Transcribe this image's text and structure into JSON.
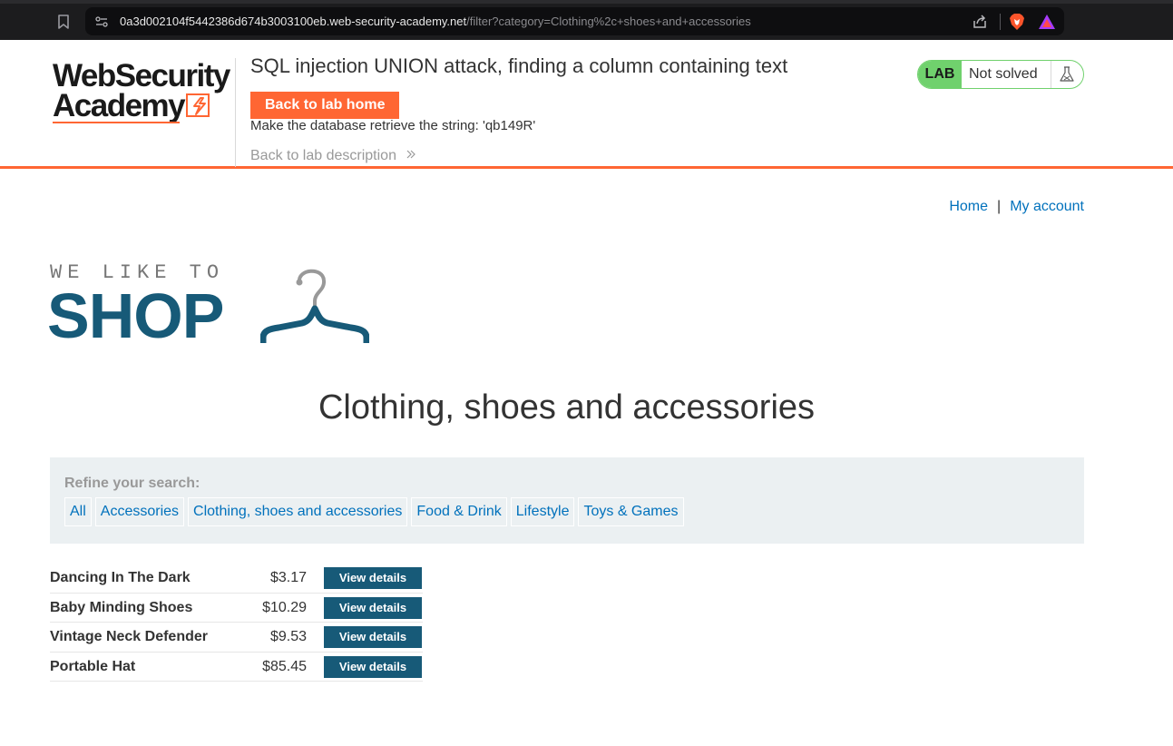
{
  "browser": {
    "url_host": "0a3d002104f5442386d674b3003100eb.web-security-academy.net",
    "url_path": "/filter?category=Clothing%2c+shoes+and+accessories",
    "icons": [
      "bookmark-icon",
      "site-info-icon",
      "share-icon",
      "brave-icon",
      "rewards-icon"
    ]
  },
  "academy": {
    "logo_line1": "WebSecurity",
    "logo_line2": "Academy",
    "lab_title": "SQL injection UNION attack, finding a column containing text",
    "back_home_label": "Back to lab home",
    "objective": "Make the database retrieve the string: 'qb149R'",
    "back_description_label": "Back to lab description",
    "lab_tag": "LAB",
    "lab_status": "Not solved",
    "accent_color": "#ff6633",
    "status_color": "#70d16d"
  },
  "shop": {
    "nav": {
      "home": "Home",
      "separator": "|",
      "my_account": "My account"
    },
    "logo_tagline": "WE LIKE TO",
    "logo_word": "SHOP",
    "heading": "Clothing, shoes and accessories",
    "filter": {
      "label": "Refine your search:",
      "categories": [
        "All",
        "Accessories",
        "Clothing, shoes and accessories",
        "Food & Drink",
        "Lifestyle",
        "Toys & Games"
      ]
    },
    "products": [
      {
        "name": "Dancing In The Dark",
        "price": "$3.17",
        "action": "View details"
      },
      {
        "name": "Baby Minding Shoes",
        "price": "$10.29",
        "action": "View details"
      },
      {
        "name": "Vintage Neck Defender",
        "price": "$9.53",
        "action": "View details"
      },
      {
        "name": "Portable Hat",
        "price": "$85.45",
        "action": "View details"
      }
    ],
    "brand_color": "#175a78",
    "link_color": "#0071bc"
  }
}
